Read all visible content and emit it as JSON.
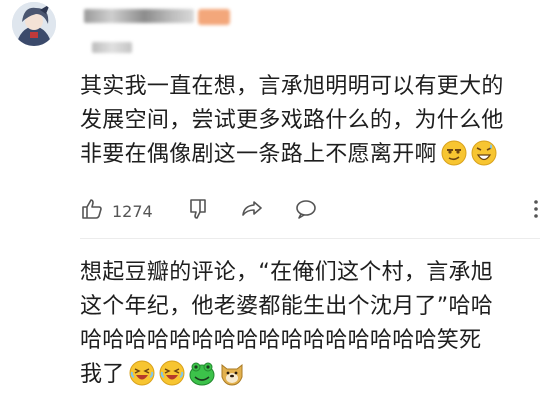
{
  "comment1": {
    "text_line1": "其实我一直在想，言承旭明明可以有更大的",
    "text_line2": "发展空间，尝试更多戏路什么的，为什么他",
    "text_line3": "非要在偶像剧这一条路上不愿离开啊",
    "like_count": "1274"
  },
  "comment2": {
    "text_line1": "想起豆瓣的评论，“在俺们这个村，言承旭",
    "text_line2": "这个年纪，他老婆都能生出个沈月了”哈哈",
    "text_line3": "哈哈哈哈哈哈哈哈哈哈哈哈哈哈哈哈笑死",
    "text_line4": "我了"
  },
  "colors": {
    "text": "#1e1e1e",
    "icon": "#555555",
    "emoji_yellow": "#f7c531",
    "frog_green": "#3cc24a"
  }
}
